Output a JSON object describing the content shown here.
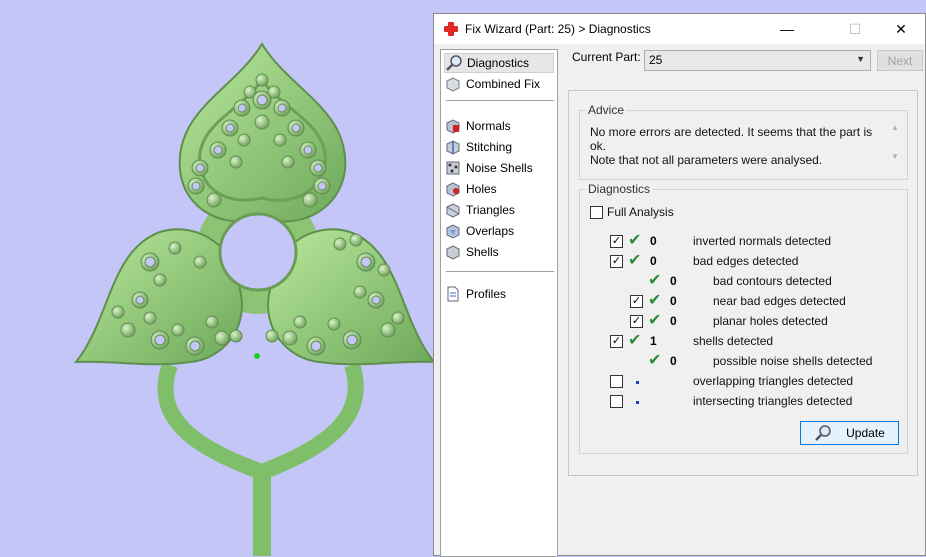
{
  "window": {
    "title": "Fix Wizard (Part: 25) > Diagnostics"
  },
  "nav": {
    "items": [
      "Diagnostics",
      "Combined Fix",
      "Normals",
      "Stitching",
      "Noise Shells",
      "Holes",
      "Triangles",
      "Overlaps",
      "Shells",
      "Profiles"
    ],
    "selected": "Diagnostics"
  },
  "current_part": {
    "label": "Current Part:",
    "value": "25"
  },
  "next_label": "Next",
  "advice": {
    "legend": "Advice",
    "line1": "No more errors are detected. It seems that the part is ok.",
    "line2": "Note that not all parameters were analysed."
  },
  "diagnostics": {
    "legend": "Diagnostics",
    "full_analysis": "Full Analysis",
    "rows": [
      {
        "count": "0",
        "label": "inverted normals detected",
        "checked": true
      },
      {
        "count": "0",
        "label": "bad edges detected",
        "checked": true
      },
      {
        "count": "0",
        "label": "bad contours detected",
        "checked": false
      },
      {
        "count": "0",
        "label": "near bad edges detected",
        "checked": true
      },
      {
        "count": "0",
        "label": "planar holes detected",
        "checked": true
      },
      {
        "count": "1",
        "label": "shells detected",
        "checked": true
      },
      {
        "count": "0",
        "label": "possible noise shells detected",
        "checked": false
      },
      {
        "count": "",
        "label": "overlapping triangles detected",
        "checked": false
      },
      {
        "count": "",
        "label": "intersecting triangles detected",
        "checked": false
      }
    ]
  },
  "update_label": "Update",
  "colors": {
    "model": "#8fcf78",
    "background": "#c4c6f8",
    "check": "#2e8b3e"
  }
}
